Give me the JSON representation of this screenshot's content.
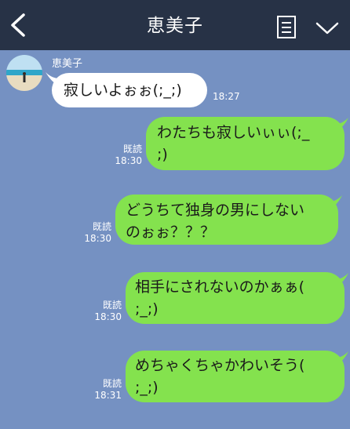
{
  "header": {
    "title": "恵美子",
    "back_icon": "chevron-left-icon",
    "notes_icon": "note-list-icon",
    "menu_icon": "chevron-down-icon",
    "bg_color": "#273246"
  },
  "chat": {
    "background_color": "#7591c2",
    "incoming_bubble_color": "#ffffff",
    "outgoing_bubble_color": "#84e24e",
    "sender_name": "恵美子",
    "messages": [
      {
        "direction": "in",
        "text": "寂しいよぉぉ(;_;)",
        "time": "18:27"
      },
      {
        "direction": "out",
        "text": "わたちも寂しいぃぃ(;_\n;)",
        "read": "既読",
        "time": "18:30"
      },
      {
        "direction": "out",
        "text": "どうちて独身の男にしない\nのぉぉ？？？",
        "read": "既読",
        "time": "18:30"
      },
      {
        "direction": "out",
        "text": "相手にされないのかぁぁ(\n;_;)",
        "read": "既読",
        "time": "18:30"
      },
      {
        "direction": "out",
        "text": "めちゃくちゃかわいそう(\n;_;)",
        "read": "既読",
        "time": "18:31"
      }
    ]
  }
}
